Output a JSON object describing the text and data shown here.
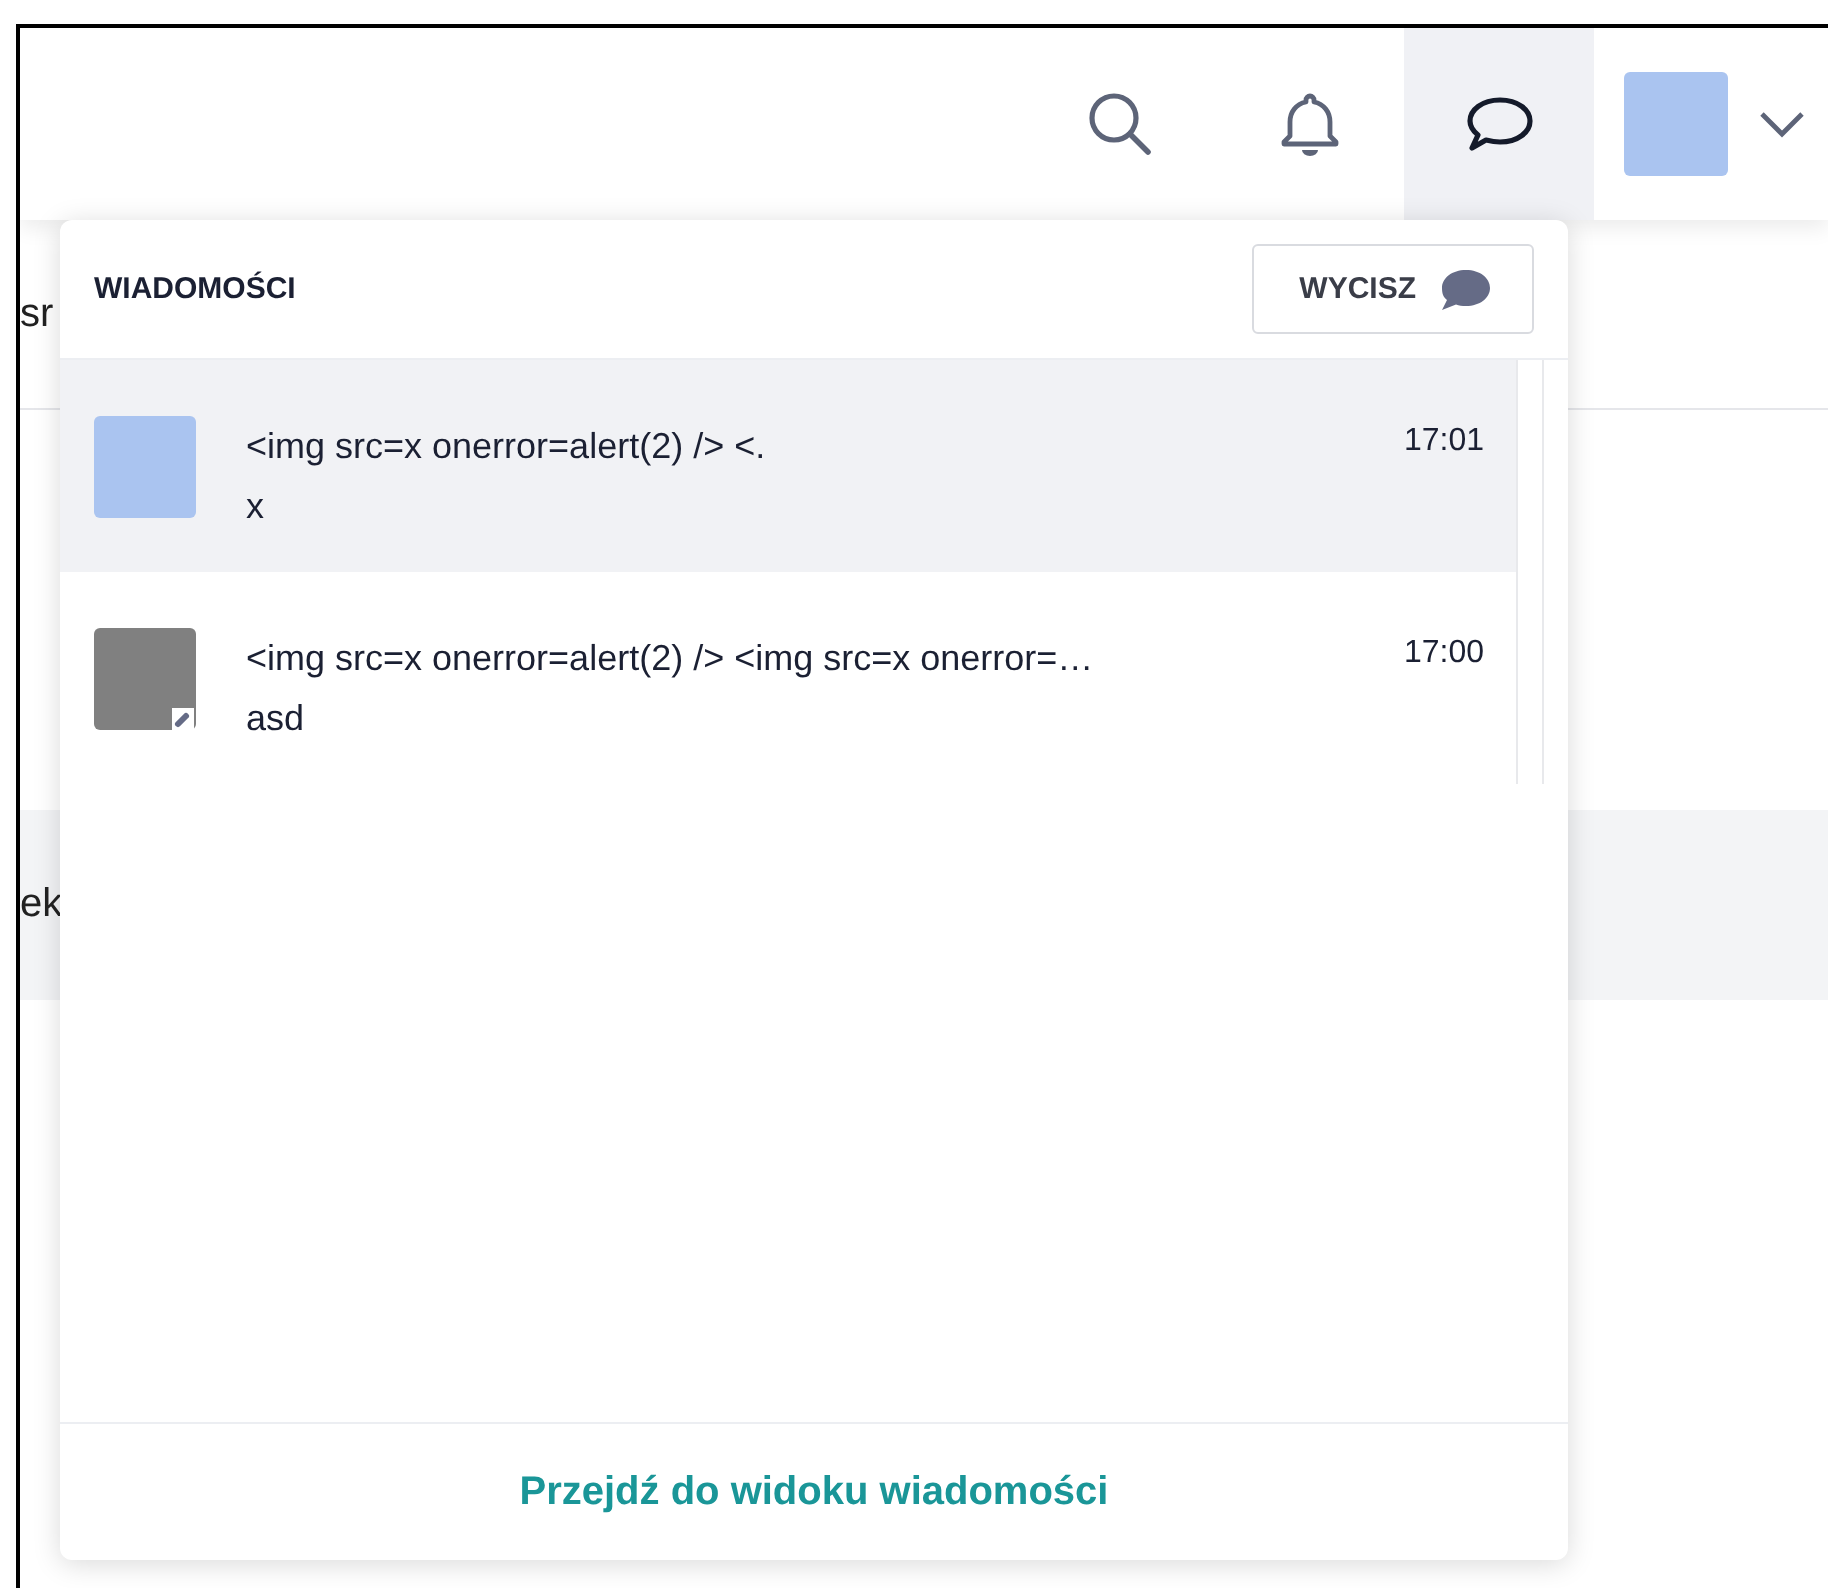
{
  "background": {
    "texts": [
      "sr",
      "ek"
    ]
  },
  "header": {
    "messages_active": true
  },
  "dropdown": {
    "title": "WIADOMOŚCI",
    "mute_button": "WYCISZ",
    "messages": [
      {
        "color": "#aac4f0",
        "unread": true,
        "badge": false,
        "preview": "<img src=x onerror=alert(2) /> <.",
        "author": "x",
        "time": "17:01"
      },
      {
        "color": "#808080",
        "unread": false,
        "badge": true,
        "preview": "<img src=x onerror=alert(2) /> <img src=x onerror=…",
        "author": "asd",
        "time": "17:00"
      }
    ],
    "footer_link": "Przejdź do widoku wiadomości"
  }
}
